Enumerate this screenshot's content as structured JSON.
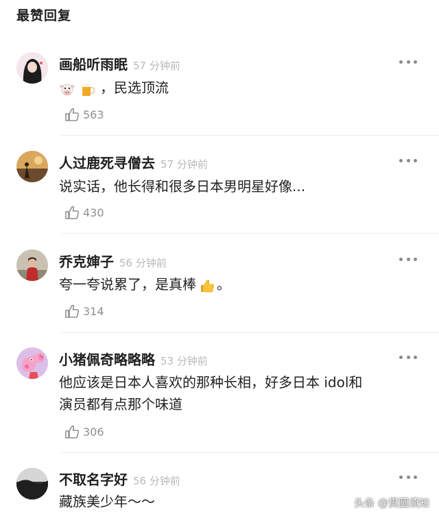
{
  "section_title": "最赞回复",
  "comments": [
    {
      "username": "画船听雨眠",
      "time": "57 分钟前",
      "text_suffix": "，民选顶流",
      "emoji": [
        "cow-face",
        "beer-mug"
      ],
      "likes": "563",
      "avatar": "avatar-girl-dark-hair"
    },
    {
      "username": "人过鹿死寻僧去",
      "time": "57 分钟前",
      "text": "说实话，他长得和很多日本男明星好像...",
      "likes": "430",
      "avatar": "avatar-landscape-figure"
    },
    {
      "username": "乔克婶子",
      "time": "56 分钟前",
      "text_prefix": "夸一夸说累了，是真棒",
      "text_suffix": "。",
      "emoji": [
        "thumbs-up"
      ],
      "likes": "314",
      "avatar": "avatar-person-red"
    },
    {
      "username": "小猪佩奇略略略",
      "time": "53 分钟前",
      "text_lines": [
        "他应该是日本人喜欢的那种长相，好多日本 idol和",
        "演员都有点那个味道"
      ],
      "likes": "306",
      "avatar": "avatar-peppa-pig"
    },
    {
      "username": "不取名字好",
      "time": "56 分钟前",
      "text": "藏族美少年～～",
      "avatar": "avatar-dark-scene"
    }
  ],
  "watermark": "头条 @贯圆须知"
}
